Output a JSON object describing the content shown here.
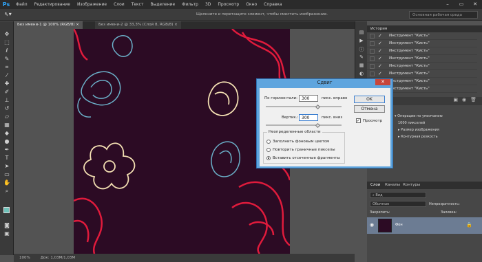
{
  "app": {
    "logo": "Ps"
  },
  "menu": [
    "Файл",
    "Редактирование",
    "Изображение",
    "Слои",
    "Текст",
    "Выделение",
    "Фильтр",
    "3D",
    "Просмотр",
    "Окно",
    "Справка"
  ],
  "window_controls": {
    "minimize": "–",
    "maximize": "▭",
    "close": "✕"
  },
  "options_bar": {
    "hint": "Щелкните и перетащите элемент, чтобы сместить изображение.",
    "workspace": "Основная рабочая среда"
  },
  "doc_tabs": [
    "Без имени-1 @ 100% (RGB/8) ×",
    "Без имени-2 @ 33,3% (Слой 8, RGB/8) ×"
  ],
  "status": {
    "zoom": "100%",
    "doc": "Док: 1,03M/1,03M"
  },
  "colors": {
    "canvas_bg": "#2c0b24",
    "accent_red": "#e01b3c",
    "accent_blue": "#6bb0c9",
    "accent_cream": "#f3dfb2",
    "dialog_frame": "#5fa5de",
    "layer_selected": "#6c7c93"
  },
  "history": {
    "title": "История",
    "items": [
      "Инструмент \"Кисть\"",
      "Инструмент \"Кисть\"",
      "Инструмент \"Кисть\"",
      "Инструмент \"Кисть\"",
      "Инструмент \"Кисть\"",
      "Инструмент \"Кисть\"",
      "Инструмент \"Кисть\"",
      "Инструмент \"Кисть\""
    ]
  },
  "actions": {
    "set": "Операции по умолчанию",
    "items": [
      "1000 пикселей",
      "Размер изображения",
      "Контурная резкость"
    ]
  },
  "layers": {
    "tabs": [
      "Слои",
      "Каналы",
      "Контуры"
    ],
    "filter": "Вид",
    "blend": "Обычные",
    "opacity_label": "Непрозрачность:",
    "lock_label": "Закрепить:",
    "fill_label": "Заливка:",
    "layer_name": "Фон"
  },
  "dialog": {
    "title": "Сдвиг",
    "horiz_label": "По горизонтали:",
    "horiz_value": "300",
    "horiz_unit": "пикс. вправо",
    "vert_label": "Вертик.:",
    "vert_value": "300",
    "vert_unit": "пикс. вниз",
    "ok": "OK",
    "cancel": "Отмена",
    "preview": "Просмотр",
    "group_title": "Неопределенные области",
    "options": [
      "Заполнить фоновым цветом",
      "Повторить граничные пикселы",
      "Вставить отсеченные фрагменты"
    ]
  }
}
